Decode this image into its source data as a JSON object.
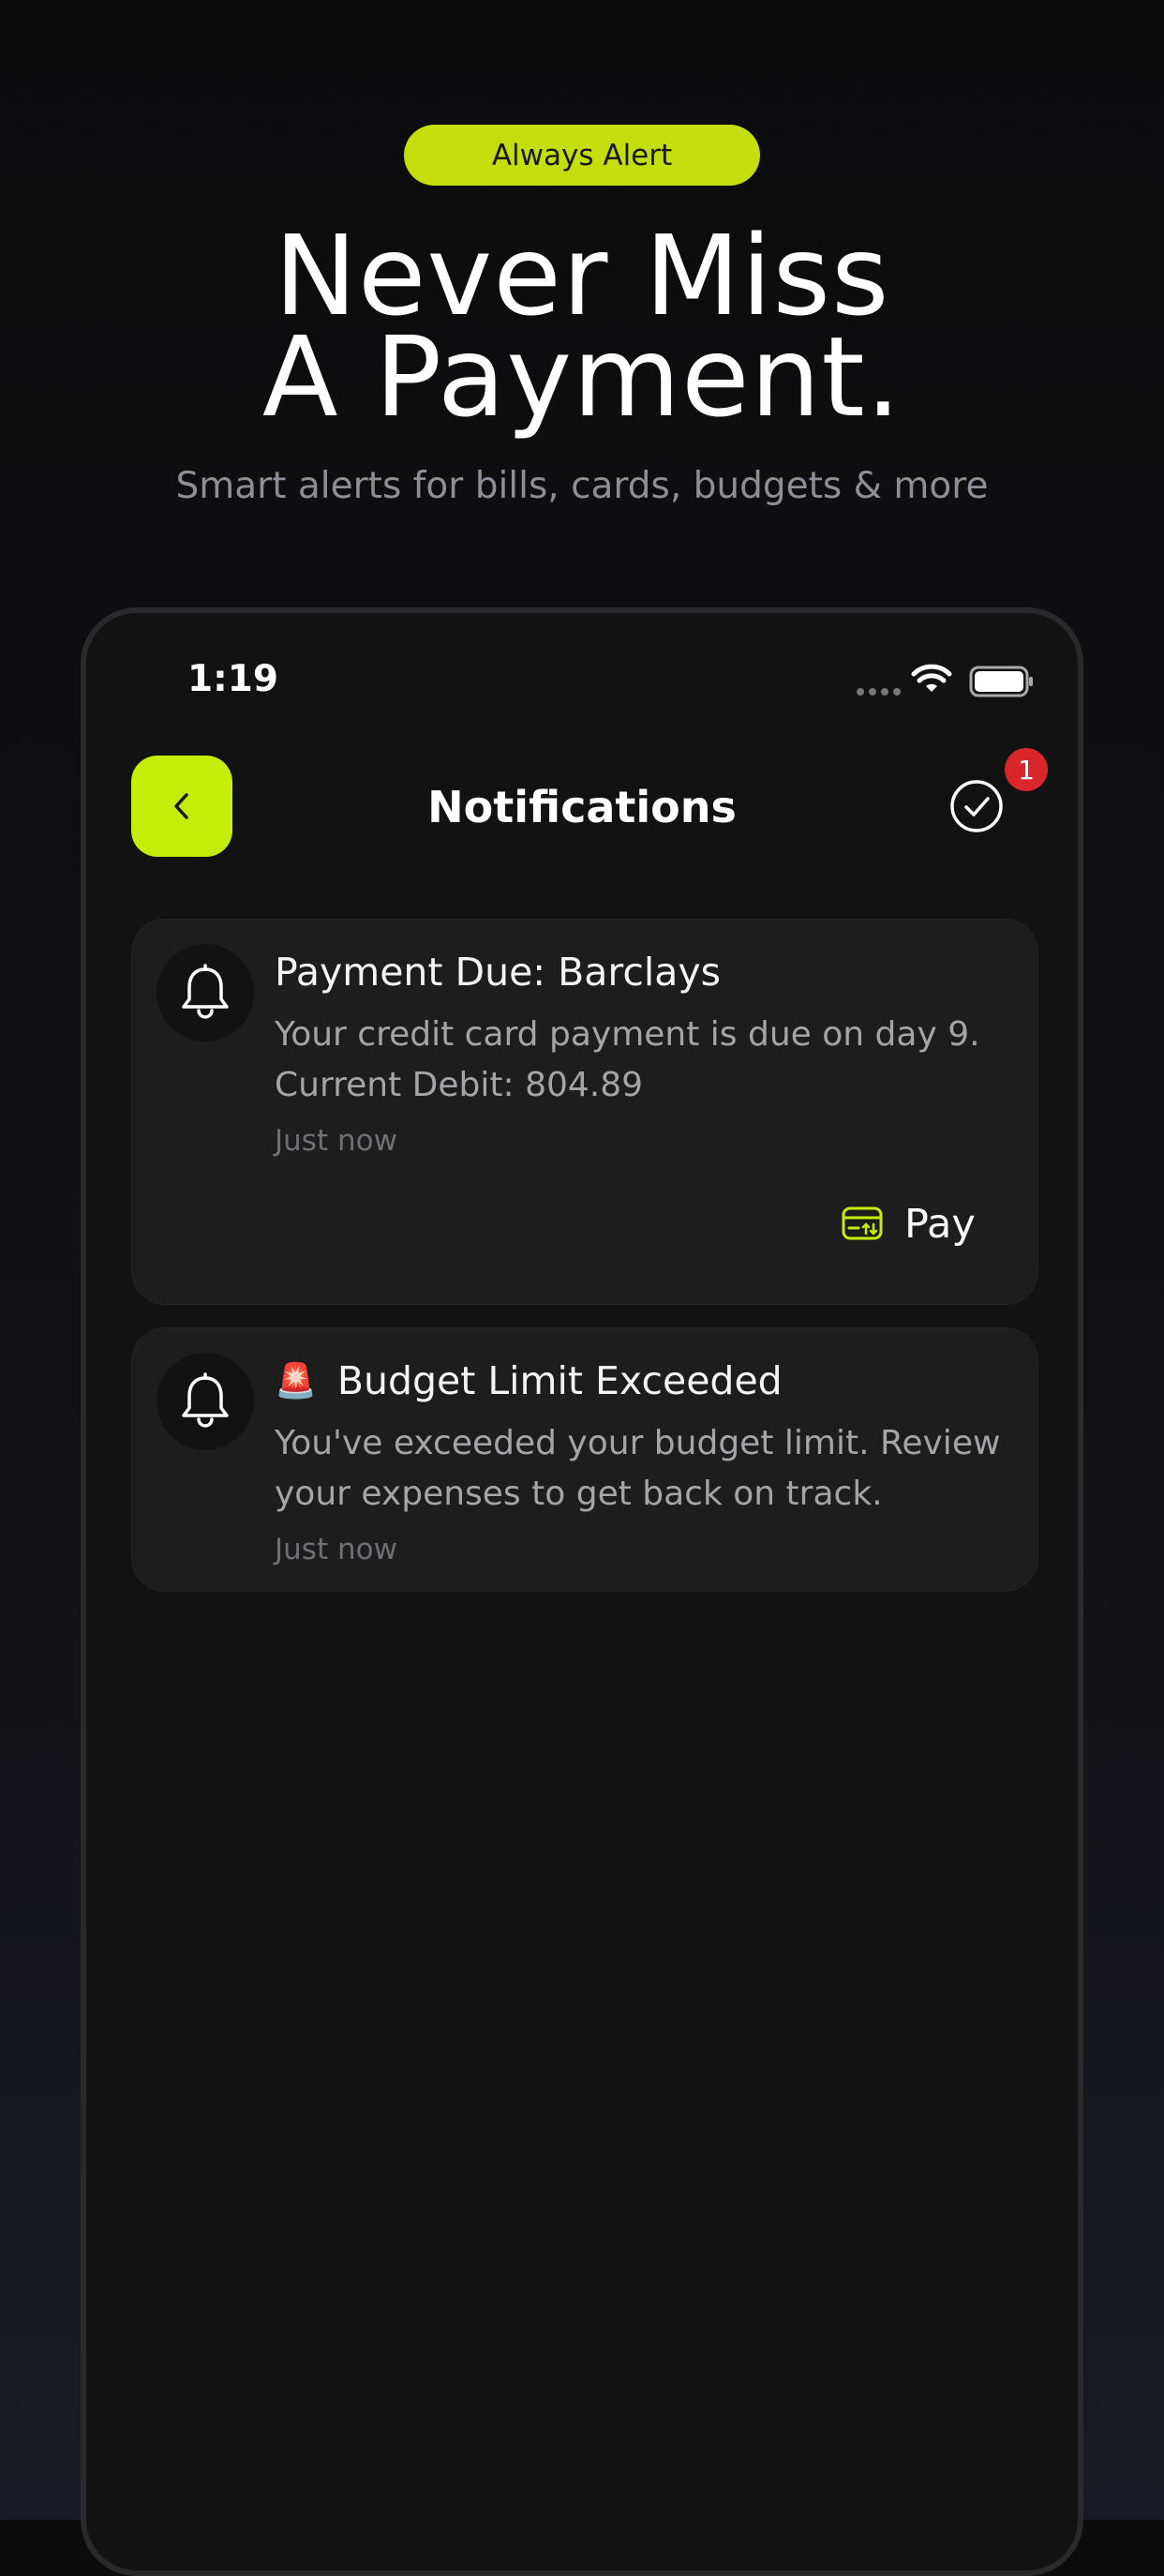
{
  "promo": {
    "pill_label": "Always Alert",
    "headline_line1": "Never Miss",
    "headline_line2": "A Payment.",
    "subheadline": "Smart alerts for bills, cards, budgets & more"
  },
  "status_bar": {
    "time": "1:19",
    "icons": [
      "signal-dots-icon",
      "wifi-icon",
      "battery-icon"
    ]
  },
  "header": {
    "back_icon": "chevron-left-icon",
    "title": "Notifications",
    "mark_read_icon": "check-circle-icon",
    "badge_count": "1"
  },
  "notifications": [
    {
      "icon": "bell-icon",
      "title": "Payment Due: Barclays",
      "body_line1": "Your credit card payment is due on day 9.",
      "body_line2": "Current Debit: 804.89",
      "time": "Just now",
      "action_icon": "card-transfer-icon",
      "action_label": "Pay"
    },
    {
      "icon": "bell-icon",
      "emoji": "🚨",
      "title": "Budget Limit Exceeded",
      "body_line1": "You've exceeded your budget limit. Review",
      "body_line2": "your expenses to get back on track.",
      "time": "Just now"
    }
  ],
  "colors": {
    "accent": "#c4ee0a",
    "badge": "#d8262a",
    "card_bg": "#1d1d1d",
    "screen_bg": "#121212"
  }
}
